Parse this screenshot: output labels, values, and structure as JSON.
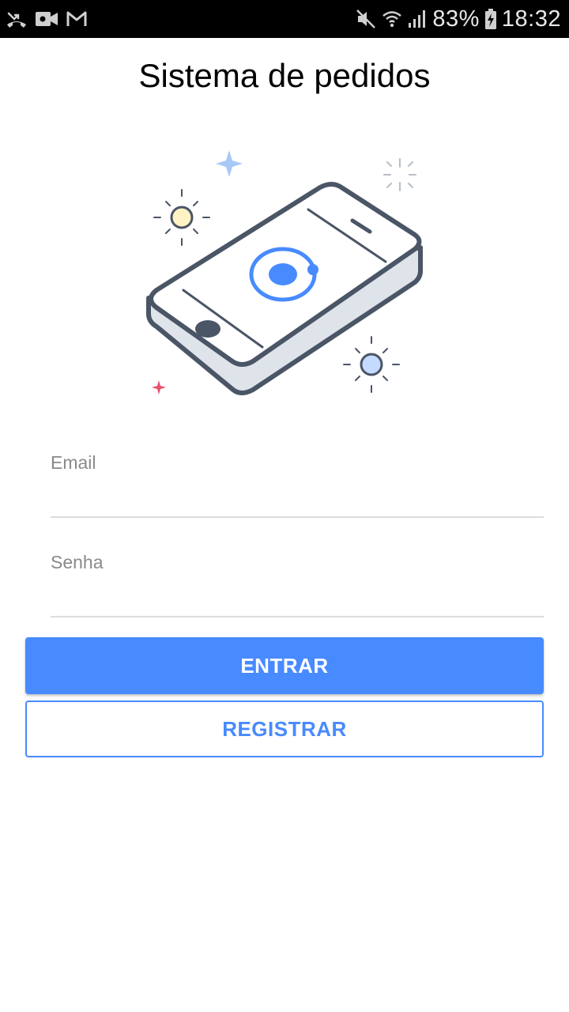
{
  "status_bar": {
    "battery_percent": "83%",
    "time": "18:32",
    "left_icons": [
      "missed-call-icon",
      "video-camera-icon",
      "gmail-icon"
    ],
    "right_icons": [
      "mute-icon",
      "wifi-icon",
      "signal-icon",
      "battery-charging-icon"
    ]
  },
  "header": {
    "title": "Sistema de pedidos"
  },
  "hero": {
    "icon": "phone-illustration-icon",
    "accent_color": "#488aff"
  },
  "form": {
    "email_label": "Email",
    "email_value": "",
    "password_label": "Senha",
    "password_value": ""
  },
  "buttons": {
    "login_label": "ENTRAR",
    "register_label": "REGISTRAR"
  },
  "colors": {
    "primary": "#488aff",
    "status_bar": "#000000",
    "background": "#ffffff"
  }
}
